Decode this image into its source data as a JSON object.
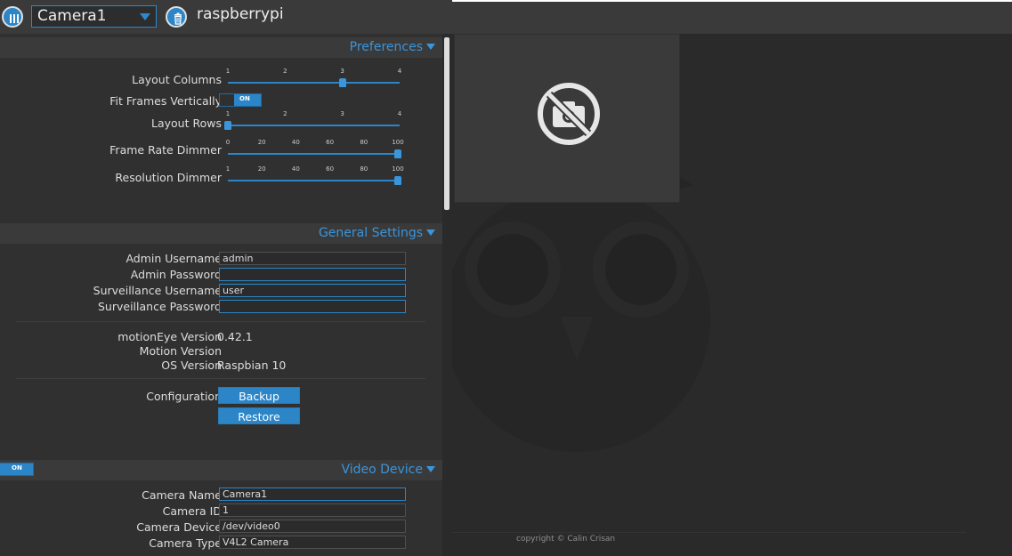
{
  "header": {
    "camera_select_value": "Camera1",
    "hostname": "raspberrypi"
  },
  "preferences": {
    "title": "Preferences",
    "layout_columns": {
      "label": "Layout Columns",
      "ticks": [
        "1",
        "2",
        "3",
        "4"
      ],
      "value": 3,
      "min": 1,
      "max": 4
    },
    "fit_frames": {
      "label": "Fit Frames Vertically",
      "state": "ON"
    },
    "layout_rows": {
      "label": "Layout Rows",
      "ticks": [
        "1",
        "2",
        "3",
        "4"
      ],
      "value": 1,
      "min": 1,
      "max": 4
    },
    "frame_rate_dimmer": {
      "label": "Frame Rate Dimmer",
      "ticks": [
        "0",
        "20",
        "40",
        "60",
        "80",
        "100"
      ],
      "value": 100,
      "min": 0,
      "max": 100
    },
    "resolution_dimmer": {
      "label": "Resolution Dimmer",
      "ticks": [
        "1",
        "20",
        "40",
        "60",
        "80",
        "100"
      ],
      "value": 100,
      "min": 0,
      "max": 100
    }
  },
  "general": {
    "title": "General Settings",
    "admin_username": {
      "label": "Admin Username",
      "value": "admin"
    },
    "admin_password": {
      "label": "Admin Password",
      "value": ""
    },
    "surv_username": {
      "label": "Surveillance Username",
      "value": "user"
    },
    "surv_password": {
      "label": "Surveillance Password",
      "value": ""
    },
    "motioneye_version": {
      "label": "motionEye Version",
      "value": "0.42.1"
    },
    "motion_version": {
      "label": "Motion Version",
      "value": ""
    },
    "os_version": {
      "label": "OS Version",
      "value": "Raspbian 10"
    },
    "configuration": {
      "label": "Configuration",
      "backup": "Backup",
      "restore": "Restore"
    }
  },
  "video_device": {
    "title": "Video Device",
    "toggle": "ON",
    "camera_name": {
      "label": "Camera Name",
      "value": "Camera1"
    },
    "camera_id": {
      "label": "Camera ID",
      "value": "1"
    },
    "camera_device": {
      "label": "Camera Device",
      "value": "/dev/video0"
    },
    "camera_type": {
      "label": "Camera Type",
      "value": "V4L2 Camera"
    }
  },
  "viewport": {
    "copyright": "copyright © Calin Crisan"
  },
  "colors": {
    "accent": "#2b85c7",
    "panel_bg": "#303030",
    "viewport_bg": "#2a2a2a"
  },
  "icons": [
    "menu-columns-icon",
    "trash-icon",
    "no-camera-icon",
    "owl-watermark"
  ]
}
